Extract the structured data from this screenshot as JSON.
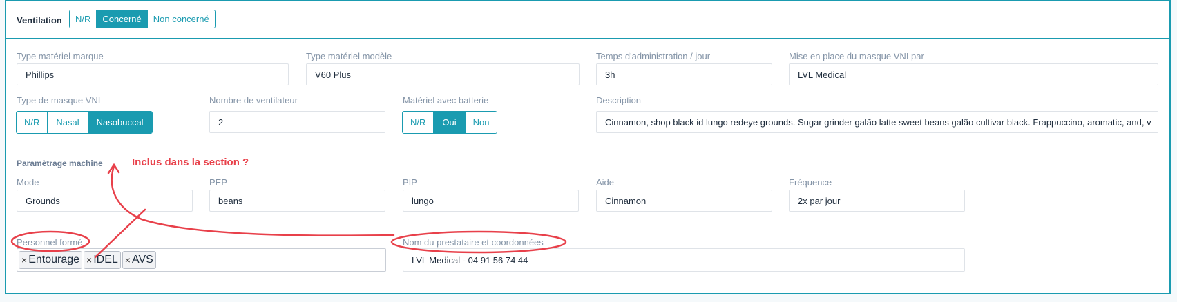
{
  "header": {
    "title": "Ventilation",
    "options": [
      {
        "label": "N/R",
        "active": false
      },
      {
        "label": "Concerné",
        "active": true
      },
      {
        "label": "Non concerné",
        "active": false
      }
    ]
  },
  "row1": {
    "marque": {
      "label": "Type matériel marque",
      "value": "Phillips"
    },
    "modele": {
      "label": "Type matériel modèle",
      "value": "V60 Plus"
    },
    "temps": {
      "label": "Temps d'administration / jour",
      "value": "3h"
    },
    "masque_par": {
      "label": "Mise en place du masque VNI par",
      "value": "LVL Medical"
    }
  },
  "row2": {
    "type_masque": {
      "label": "Type de masque VNI",
      "options": [
        {
          "label": "N/R",
          "active": false
        },
        {
          "label": "Nasal",
          "active": false
        },
        {
          "label": "Nasobuccal",
          "active": true
        }
      ]
    },
    "nb_ventilateur": {
      "label": "Nombre de ventilateur",
      "value": "2"
    },
    "batterie": {
      "label": "Matériel avec batterie",
      "options": [
        {
          "label": "N/R",
          "active": false
        },
        {
          "label": "Oui",
          "active": true
        },
        {
          "label": "Non",
          "active": false
        }
      ]
    },
    "description": {
      "label": "Description",
      "value": "Cinnamon, shop black id lungo redeye grounds. Sugar grinder galão latte sweet beans galão cultivar black. Frappuccino, aromatic, and, v"
    }
  },
  "section": {
    "title": "Paramètrage machine",
    "annotation": "Inclus dans la section ?"
  },
  "row3": {
    "mode": {
      "label": "Mode",
      "value": "Grounds"
    },
    "pep": {
      "label": "PEP",
      "value": "beans"
    },
    "pip": {
      "label": "PIP",
      "value": "lungo"
    },
    "aide": {
      "label": "Aide",
      "value": "Cinnamon"
    },
    "frequence": {
      "label": "Fréquence",
      "value": "2x par jour"
    }
  },
  "row4": {
    "personnel": {
      "label": "Personnel formé",
      "tags": [
        "Entourage",
        "IDEL",
        "AVS"
      ],
      "remove_glyph": "×"
    },
    "prestataire": {
      "label": "Nom du prestataire et coordonnées",
      "value": "LVL Medical - 04 91 56 74 44"
    }
  },
  "colors": {
    "accent": "#1a9bb0",
    "annotation": "#e8404a"
  }
}
